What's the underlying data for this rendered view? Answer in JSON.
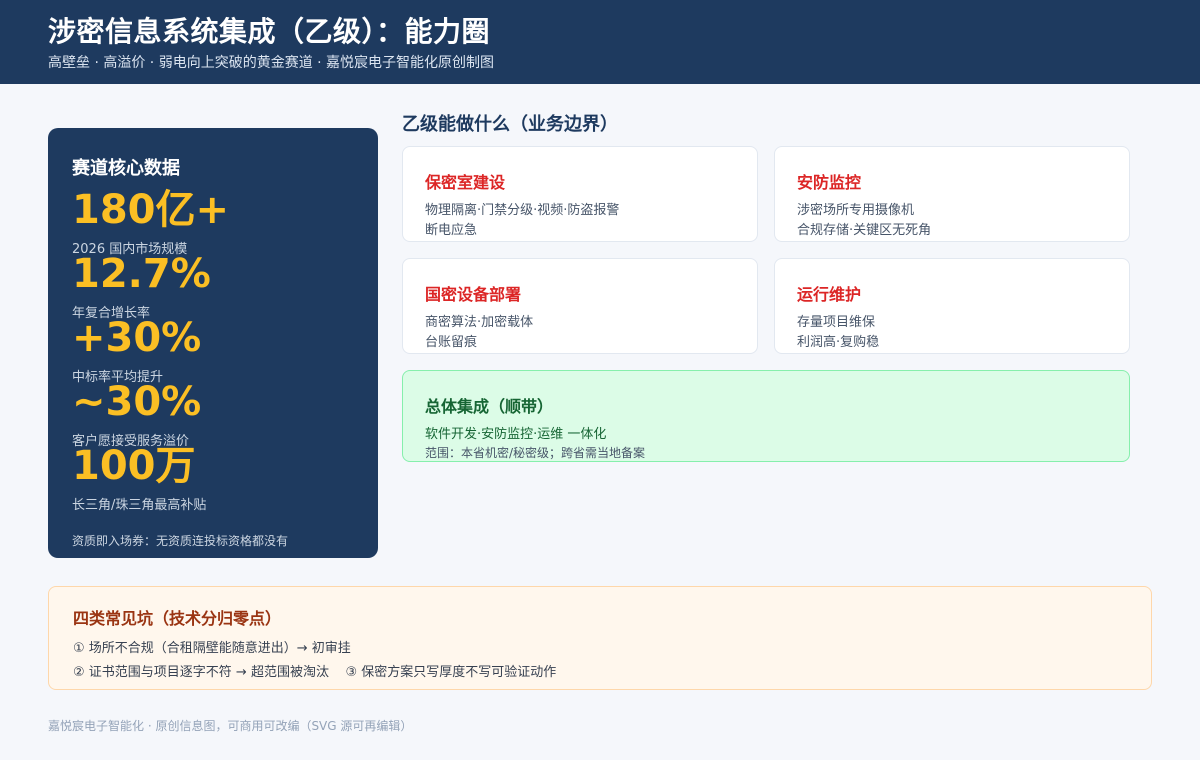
{
  "header": {
    "title": "涉密信息系统集成（乙级）：能力圈",
    "subtitle": "高壁垒 · 高溢价 · 弱电向上突破的黄金赛道 · 嘉悦宸电子智能化原创制图"
  },
  "stats": {
    "title": "赛道核心数据",
    "items": [
      {
        "value": "180亿+",
        "label": "2026 国内市场规模"
      },
      {
        "value": "12.7%",
        "label": "年复合增长率"
      },
      {
        "value": "+30%",
        "label": "中标率平均提升"
      },
      {
        "value": "~30%",
        "label": "客户愿接受服务溢价"
      },
      {
        "value": "100万",
        "label": "长三角/珠三角最高补贴"
      }
    ],
    "footnote": "资质即入场券：无资质连投标资格都没有"
  },
  "scope": {
    "title": "乙级能做什么（业务边界）",
    "cards": [
      {
        "title": "保密室建设",
        "lines": [
          "物理隔离·门禁分级·视频·防盗报警",
          "断电应急"
        ]
      },
      {
        "title": "安防监控",
        "lines": [
          "涉密场所专用摄像机",
          "合规存储·关键区无死角"
        ]
      },
      {
        "title": "国密设备部署",
        "lines": [
          "商密算法·加密载体",
          "台账留痕"
        ]
      },
      {
        "title": "运行维护",
        "lines": [
          "存量项目维保",
          "利润高·复购稳"
        ]
      }
    ],
    "overall": {
      "title": "总体集成（顺带）",
      "line1": "软件开发·安防监控·运维 一体化",
      "line2": "范围：本省机密/秘密级；跨省需当地备案"
    }
  },
  "pitfalls": {
    "title": "四类常见坑（技术分归零点）",
    "line1": "① 场所不合规（合租隔壁能随意进出）→ 初审挂",
    "line2": "② 证书范围与项目逐字不符 → 超范围被淘汰    ③ 保密方案只写厚度不写可验证动作"
  },
  "footer": "嘉悦宸电子智能化 · 原创信息图，可商用可改编（SVG 源可再编辑）",
  "colors": {
    "navy": "#1e3a5f",
    "gold": "#fbbf24",
    "red": "#dc2626",
    "green": "#166534",
    "orange": "#9a3412"
  }
}
